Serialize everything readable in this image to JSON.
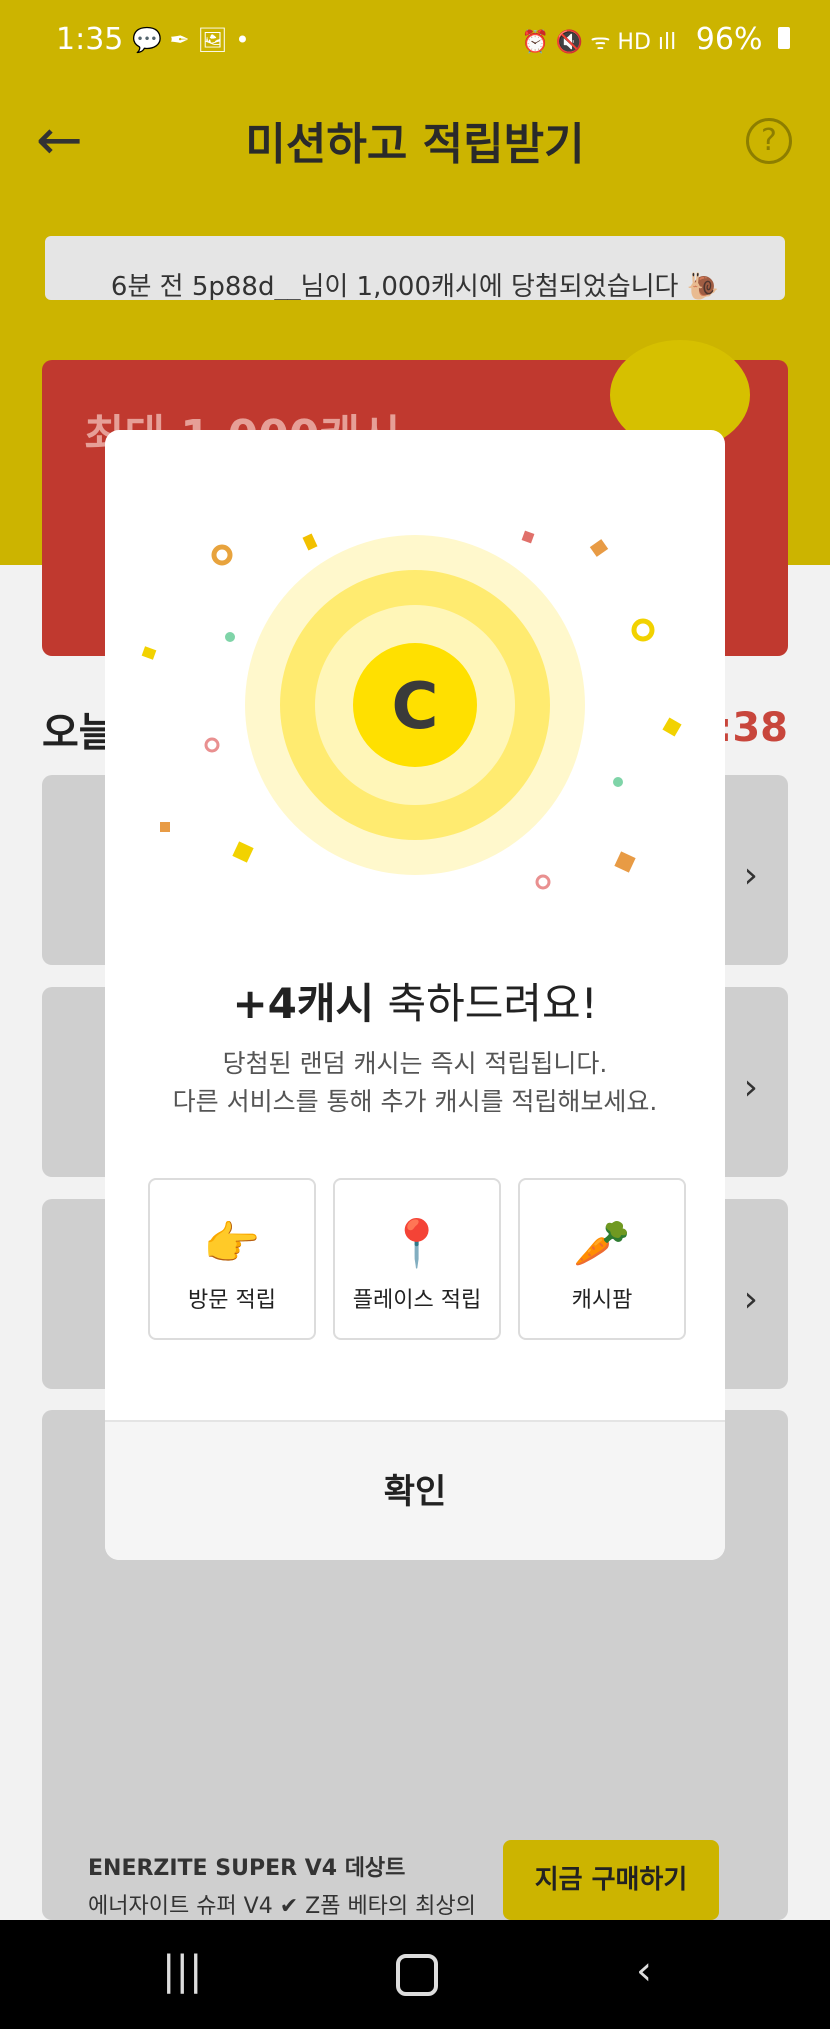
{
  "status_bar": {
    "time": "1:35",
    "notif_icons": "💬 ✒ 🖼 •",
    "right_icons": "⏰ 🔇 ᯤ HD ıll",
    "battery": "96%"
  },
  "header": {
    "title": "미션하고 적립받기",
    "ticker": "6분 전 5p88d__님이 1,000캐시에 당첨되었습니다 🐌",
    "banner_title": "최대 1,000캐시",
    "section_title": "오늘",
    "timer": "5:38"
  },
  "product": {
    "name": "ENERZITE SUPER V4 데상트",
    "subtitle": "에너자이트 슈퍼 V4 ✔ Z폼 베타의 최상의",
    "buy_label": "지금 구매하기"
  },
  "modal": {
    "amount": "+4캐시",
    "congrats": "축하드려요!",
    "desc_line1": "당첨된 랜덤 캐시는 즉시 적립됩니다.",
    "desc_line2": "다른 서비스를 통해 추가 캐시를 적립해보세요.",
    "options": [
      {
        "label": "방문 적립",
        "icon": "pointing-hand-icon"
      },
      {
        "label": "플레이스 적립",
        "icon": "map-pin-icon"
      },
      {
        "label": "캐시팜",
        "icon": "carrot-icon"
      }
    ],
    "confirm_label": "확인",
    "coin_letter": "C"
  },
  "colors": {
    "accent_yellow": "#FFE000",
    "banner_red": "#C0392F"
  }
}
